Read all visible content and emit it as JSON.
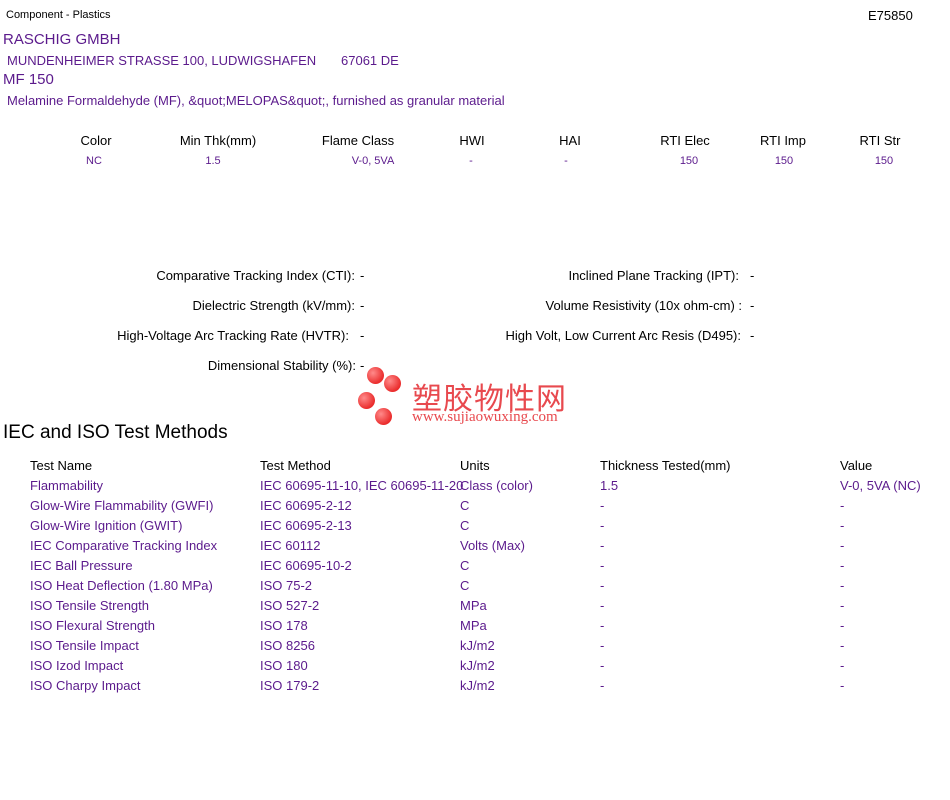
{
  "header": {
    "category": "Component - Plastics",
    "file_number": "E75850"
  },
  "company": {
    "name": "RASCHIG GMBH",
    "address": "MUNDENHEIMER STRASSE 100, LUDWIGSHAFEN",
    "postal": "67061 DE"
  },
  "product": {
    "grade": "MF 150",
    "description": "Melamine Formaldehyde (MF), &quot;MELOPAS&quot;, furnished as granular material"
  },
  "ratings": {
    "headers": [
      "Color",
      "Min Thk(mm)",
      "Flame Class",
      "HWI",
      "HAI",
      "RTI Elec",
      "RTI Imp",
      "RTI Str"
    ],
    "values": [
      "NC",
      "1.5",
      "V-0, 5VA",
      "-",
      "-",
      "150",
      "150",
      "150"
    ]
  },
  "properties": {
    "left": [
      {
        "label": "Comparative Tracking Index (CTI):",
        "value": "-"
      },
      {
        "label": "Dielectric Strength (kV/mm):",
        "value": "-"
      },
      {
        "label": "High-Voltage Arc Tracking Rate (HVTR):",
        "value": "-"
      },
      {
        "label": "Dimensional Stability (%):",
        "value": "-"
      }
    ],
    "right": [
      {
        "label": "Inclined Plane Tracking (IPT):",
        "value": "-"
      },
      {
        "label": "Volume Resistivity (10x ohm-cm) :",
        "value": "-"
      },
      {
        "label": "High Volt, Low Current Arc Resis (D495):",
        "value": "-"
      }
    ]
  },
  "watermark": {
    "chinese": "塑胶物性网",
    "url": "www.sujiaowuxing.com"
  },
  "test_methods": {
    "title": "IEC and ISO Test Methods",
    "headers": [
      "Test Name",
      "Test Method",
      "Units",
      "Thickness Tested(mm)",
      "Value"
    ],
    "rows": [
      [
        "Flammability",
        "IEC 60695-11-10, IEC 60695-11-20",
        "Class (color)",
        "1.5",
        "V-0, 5VA (NC)"
      ],
      [
        "Glow-Wire Flammability (GWFI)",
        "IEC 60695-2-12",
        "C",
        "-",
        "-"
      ],
      [
        "Glow-Wire Ignition (GWIT)",
        "IEC 60695-2-13",
        "C",
        "-",
        "-"
      ],
      [
        "IEC Comparative Tracking Index",
        "IEC 60112",
        "Volts (Max)",
        "-",
        "-"
      ],
      [
        "IEC Ball Pressure",
        "IEC 60695-10-2",
        "C",
        "-",
        "-"
      ],
      [
        "ISO Heat Deflection (1.80 MPa)",
        "ISO 75-2",
        "C",
        "-",
        "-"
      ],
      [
        "ISO Tensile Strength",
        "ISO 527-2",
        "MPa",
        "-",
        "-"
      ],
      [
        "ISO Flexural Strength",
        "ISO 178",
        "MPa",
        "-",
        "-"
      ],
      [
        "ISO Tensile Impact",
        "ISO 8256",
        "kJ/m2",
        "-",
        "-"
      ],
      [
        "ISO Izod Impact",
        "ISO 180",
        "kJ/m2",
        "-",
        "-"
      ],
      [
        "ISO Charpy Impact",
        "ISO 179-2",
        "kJ/m2",
        "-",
        "-"
      ]
    ]
  },
  "colors": {
    "accent": "#5b1a8c",
    "watermark": "#e8494e"
  }
}
